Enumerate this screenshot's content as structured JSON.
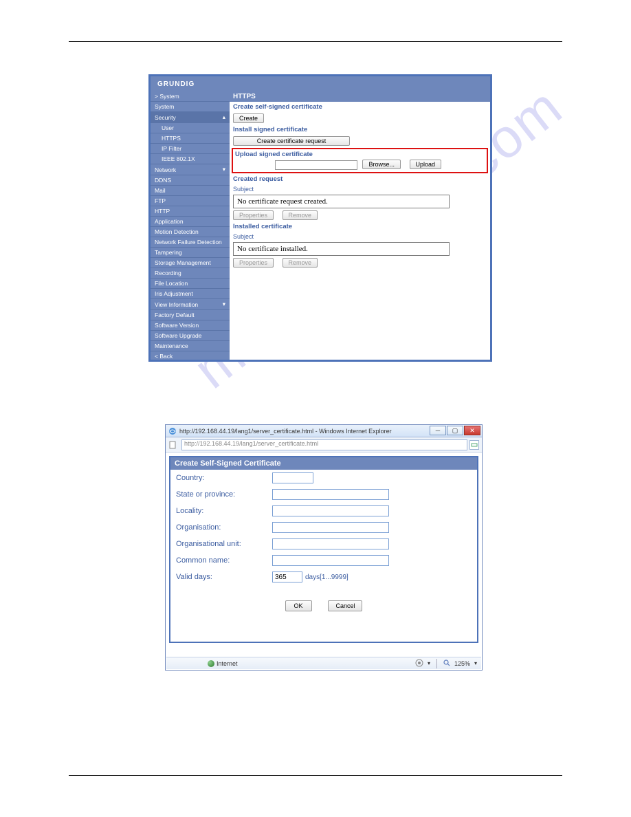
{
  "screenshot1": {
    "logo": "GRUNDIG",
    "sidebar": {
      "system_label": "> System",
      "items": [
        "System",
        "Security",
        "User",
        "HTTPS",
        "IP Filter",
        "IEEE 802.1X",
        "Network",
        "DDNS",
        "Mail",
        "FTP",
        "HTTP",
        "Application",
        "Motion Detection",
        "Network Failure Detection",
        "Tampering",
        "Storage Management",
        "Recording",
        "File Location",
        "Iris Adjustment",
        "View Information",
        "Factory Default",
        "Software Version",
        "Software Upgrade",
        "Maintenance",
        "< Back"
      ]
    },
    "main": {
      "title": "HTTPS",
      "create_self_label": "Create self-signed certificate",
      "create_btn": "Create",
      "install_label": "Install signed certificate",
      "create_req_btn": "Create certificate request",
      "upload_label": "Upload signed certificate",
      "browse_btn": "Browse...",
      "upload_btn": "Upload",
      "created_req_label": "Created request",
      "subject_label": "Subject",
      "subject_value1": "No certificate request created.",
      "properties_btn": "Properties",
      "remove_btn": "Remove",
      "installed_label": "Installed certificate",
      "subject_value2": "No certificate installed."
    }
  },
  "screenshot2": {
    "window_title": "http://192.168.44.19/lang1/server_certificate.html - Windows Internet Explorer",
    "address": "http://192.168.44.19/lang1/server_certificate.html",
    "form": {
      "title": "Create Self-Signed Certificate",
      "country": "Country:",
      "state": "State or province:",
      "locality": "Locality:",
      "org": "Organisation:",
      "orgunit": "Organisational unit:",
      "common": "Common name:",
      "valid": "Valid days:",
      "valid_value": "365",
      "days_hint": "days[1...9999]",
      "ok": "OK",
      "cancel": "Cancel"
    },
    "status": {
      "internet": "Internet",
      "zoom": "125%"
    }
  },
  "watermark": "manualshive.com",
  "page_number": ""
}
